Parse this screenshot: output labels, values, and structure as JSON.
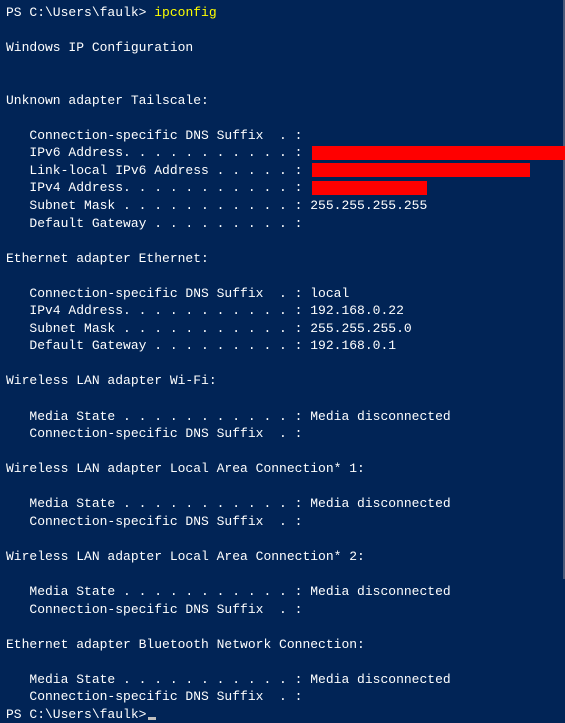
{
  "prompt1_prefix": "PS C:\\Users\\faulk> ",
  "prompt1_cmd": "ipconfig",
  "header": "Windows IP Configuration",
  "sections": [
    {
      "title": "Unknown adapter Tailscale:",
      "rows": [
        {
          "label": "   Connection-specific DNS Suffix  . :",
          "value": ""
        },
        {
          "label": "   IPv6 Address. . . . . . . . . . . :",
          "value": "",
          "redact": "redact-1"
        },
        {
          "label": "   Link-local IPv6 Address . . . . . :",
          "value": "",
          "redact": "redact-2"
        },
        {
          "label": "   IPv4 Address. . . . . . . . . . . :",
          "value": "",
          "redact": "redact-3"
        },
        {
          "label": "   Subnet Mask . . . . . . . . . . . :",
          "value": " 255.255.255.255"
        },
        {
          "label": "   Default Gateway . . . . . . . . . :",
          "value": ""
        }
      ]
    },
    {
      "title": "Ethernet adapter Ethernet:",
      "rows": [
        {
          "label": "   Connection-specific DNS Suffix  . :",
          "value": " local"
        },
        {
          "label": "   IPv4 Address. . . . . . . . . . . :",
          "value": " 192.168.0.22"
        },
        {
          "label": "   Subnet Mask . . . . . . . . . . . :",
          "value": " 255.255.255.0"
        },
        {
          "label": "   Default Gateway . . . . . . . . . :",
          "value": " 192.168.0.1"
        }
      ]
    },
    {
      "title": "Wireless LAN adapter Wi-Fi:",
      "rows": [
        {
          "label": "   Media State . . . . . . . . . . . :",
          "value": " Media disconnected"
        },
        {
          "label": "   Connection-specific DNS Suffix  . :",
          "value": ""
        }
      ]
    },
    {
      "title": "Wireless LAN adapter Local Area Connection* 1:",
      "rows": [
        {
          "label": "   Media State . . . . . . . . . . . :",
          "value": " Media disconnected"
        },
        {
          "label": "   Connection-specific DNS Suffix  . :",
          "value": ""
        }
      ]
    },
    {
      "title": "Wireless LAN adapter Local Area Connection* 2:",
      "rows": [
        {
          "label": "   Media State . . . . . . . . . . . :",
          "value": " Media disconnected"
        },
        {
          "label": "   Connection-specific DNS Suffix  . :",
          "value": ""
        }
      ]
    },
    {
      "title": "Ethernet adapter Bluetooth Network Connection:",
      "rows": [
        {
          "label": "   Media State . . . . . . . . . . . :",
          "value": " Media disconnected"
        },
        {
          "label": "   Connection-specific DNS Suffix  . :",
          "value": ""
        }
      ]
    }
  ],
  "prompt2_prefix": "PS C:\\Users\\faulk>"
}
